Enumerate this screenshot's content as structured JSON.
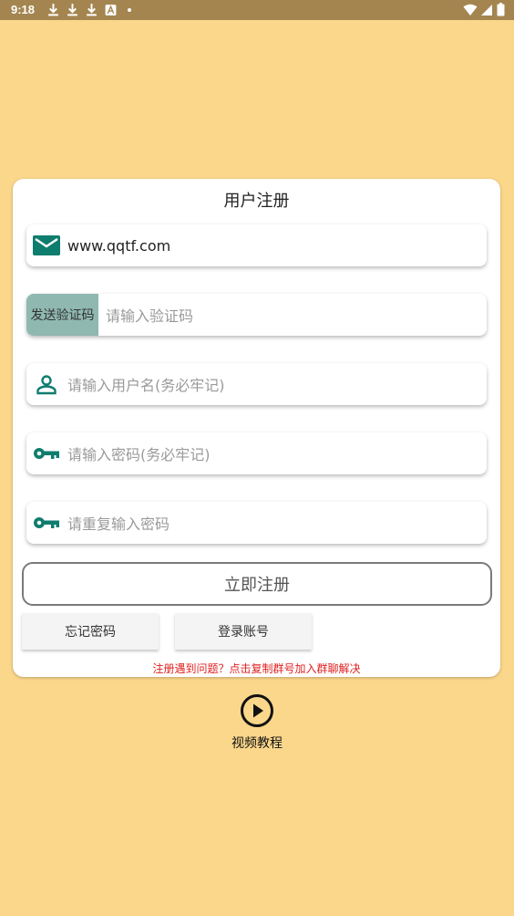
{
  "status_bar": {
    "time": "9:18",
    "icons": [
      "download-icon",
      "download-icon",
      "download-icon",
      "font-icon",
      "dot"
    ],
    "right_icons": [
      "wifi-icon",
      "signal-icon",
      "battery-icon"
    ]
  },
  "form": {
    "title": "用户注册",
    "email_value": "www.qqtf.com",
    "send_code_label": "发送验证码",
    "code_placeholder": "请输入验证码",
    "username_placeholder": "请输入用户名(务必牢记)",
    "password_placeholder": "请输入密码(务必牢记)",
    "confirm_password_placeholder": "请重复输入密码",
    "register_label": "立即注册",
    "forgot_password_label": "忘记密码",
    "login_label": "登录账号",
    "hint": "注册遇到问题？点击复制群号加入群聊解决"
  },
  "video": {
    "label": "视频教程",
    "icon": "play-circle-icon"
  },
  "colors": {
    "background": "#FBD78B",
    "status_bar": "#A48550",
    "icon_teal": "#0E7D6E",
    "send_code_bg": "#8FB8B0",
    "hint_red": "#E02020"
  }
}
